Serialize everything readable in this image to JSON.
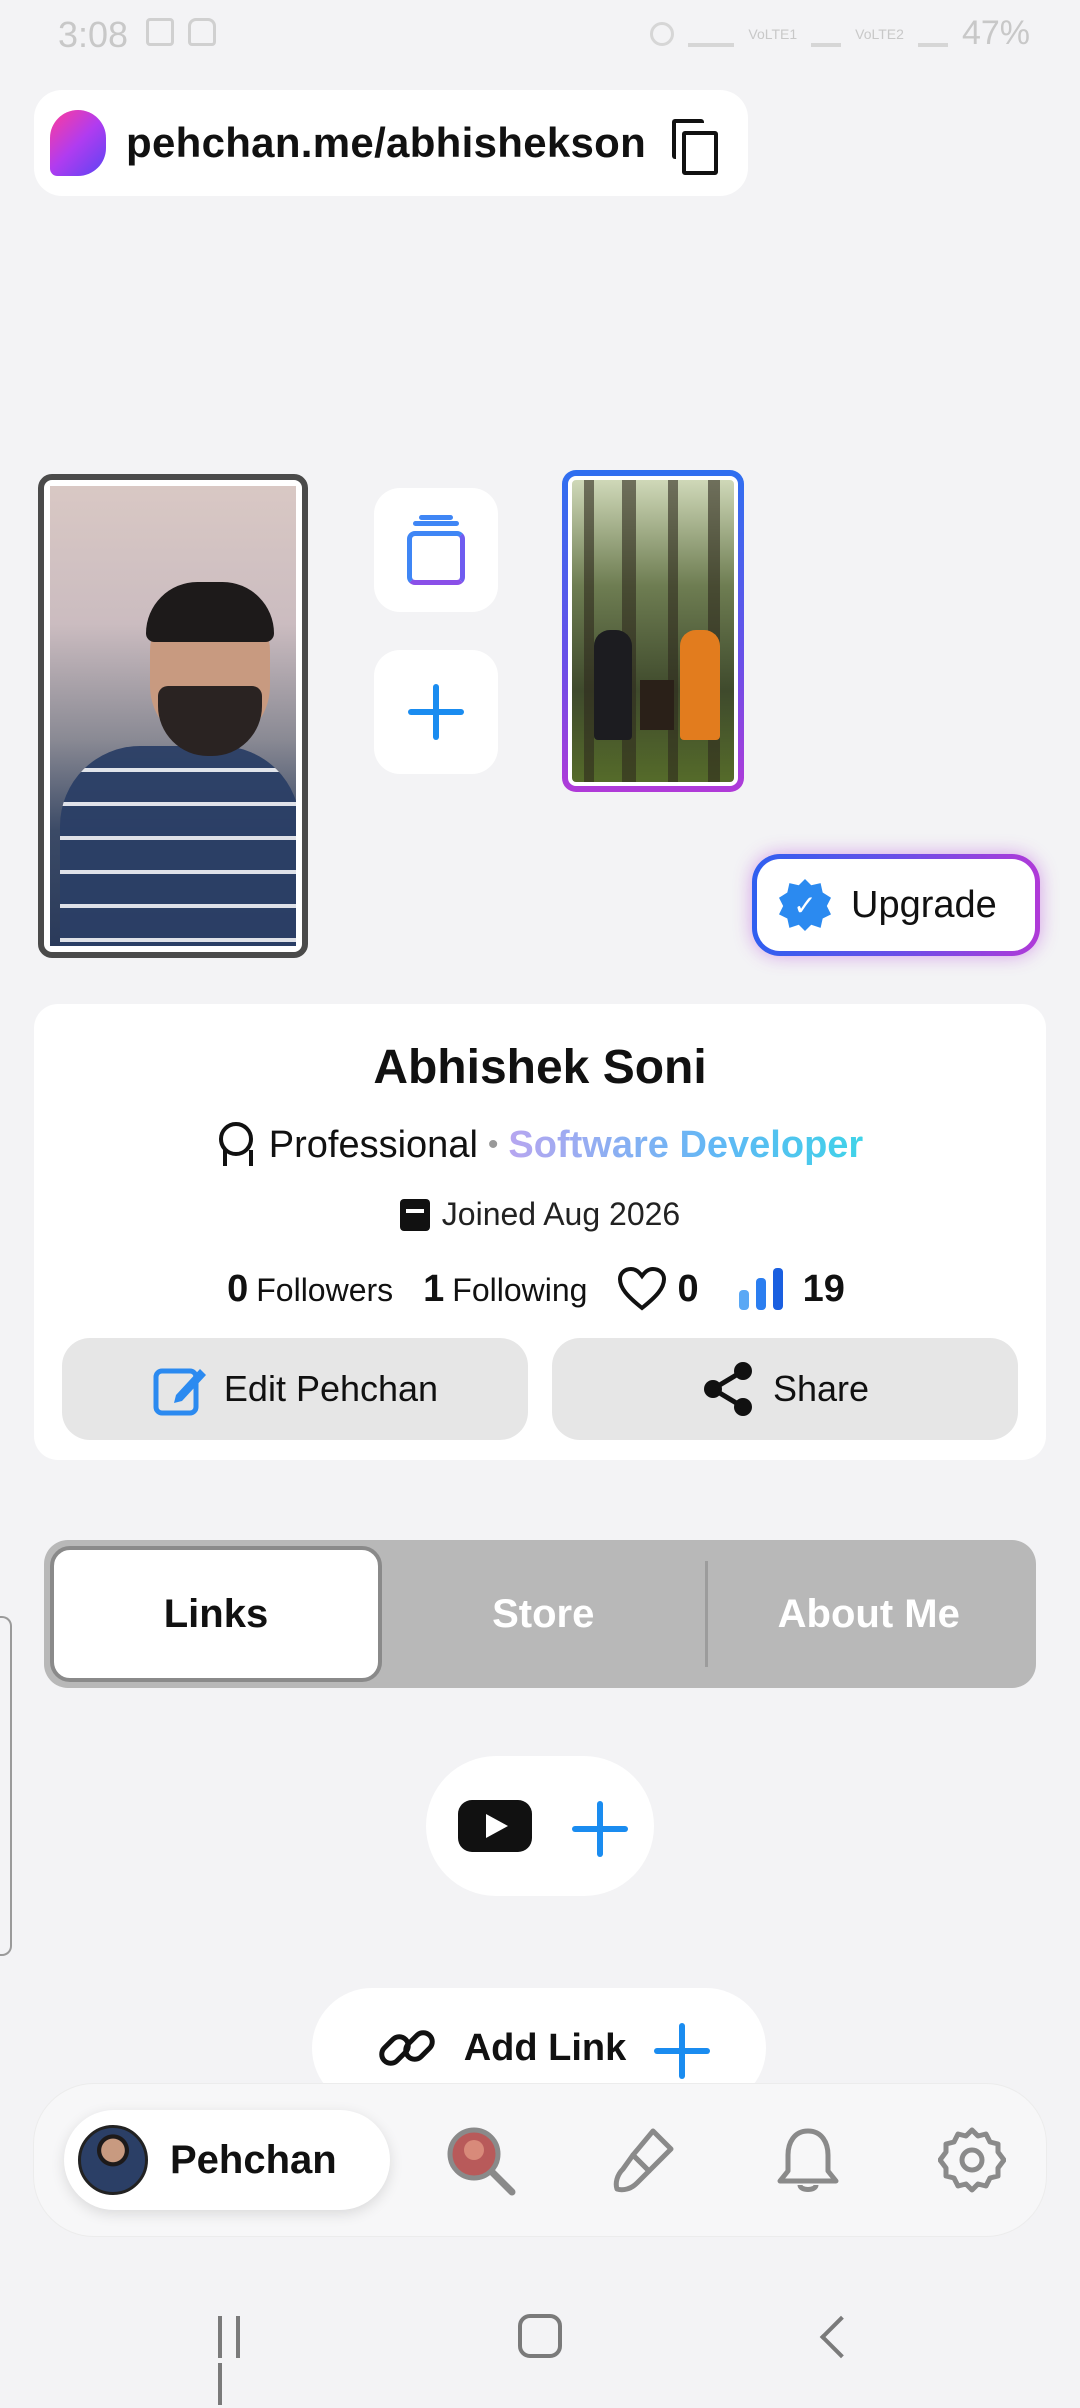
{
  "status_bar": {
    "time": "3:08",
    "network_1": "VoLTE1",
    "network_2": "VoLTE2",
    "battery": "47%"
  },
  "header": {
    "url": "pehchan.me/abhishekson",
    "logo_icon": "pehchan-logo-icon",
    "copy_icon": "copy-icon"
  },
  "gallery": {
    "stack_icon": "stack-icon",
    "add_icon": "plus-icon"
  },
  "upgrade": {
    "label": "Upgrade",
    "badge_icon": "verified-badge-icon",
    "gradient": [
      "#2f5ff0",
      "#6a4fe8",
      "#b03ad8"
    ]
  },
  "profile": {
    "name": "Abhishek Soni",
    "type": "Professional",
    "separator": "•",
    "profession": "Software Developer",
    "joined": "Joined Aug 2026",
    "followers_count": "0",
    "followers_label": "Followers",
    "following_count": "1",
    "following_label": "Following",
    "likes": "0",
    "views": "19",
    "edit_label": "Edit Pehchan",
    "share_label": "Share"
  },
  "tabs": [
    {
      "label": "Links",
      "active": true
    },
    {
      "label": "Store",
      "active": false
    },
    {
      "label": "About Me",
      "active": false
    }
  ],
  "links": {
    "youtube_icon": "youtube-icon",
    "add_link_label": "Add Link"
  },
  "bottom_nav": {
    "home_label": "Pehchan",
    "items": [
      "search-icon",
      "brush-icon",
      "bell-icon",
      "gear-icon"
    ]
  },
  "colors": {
    "accent_blue": "#1a8cf0",
    "page_bg": "#f3f3f5",
    "tab_bg": "#b8b8b8"
  }
}
